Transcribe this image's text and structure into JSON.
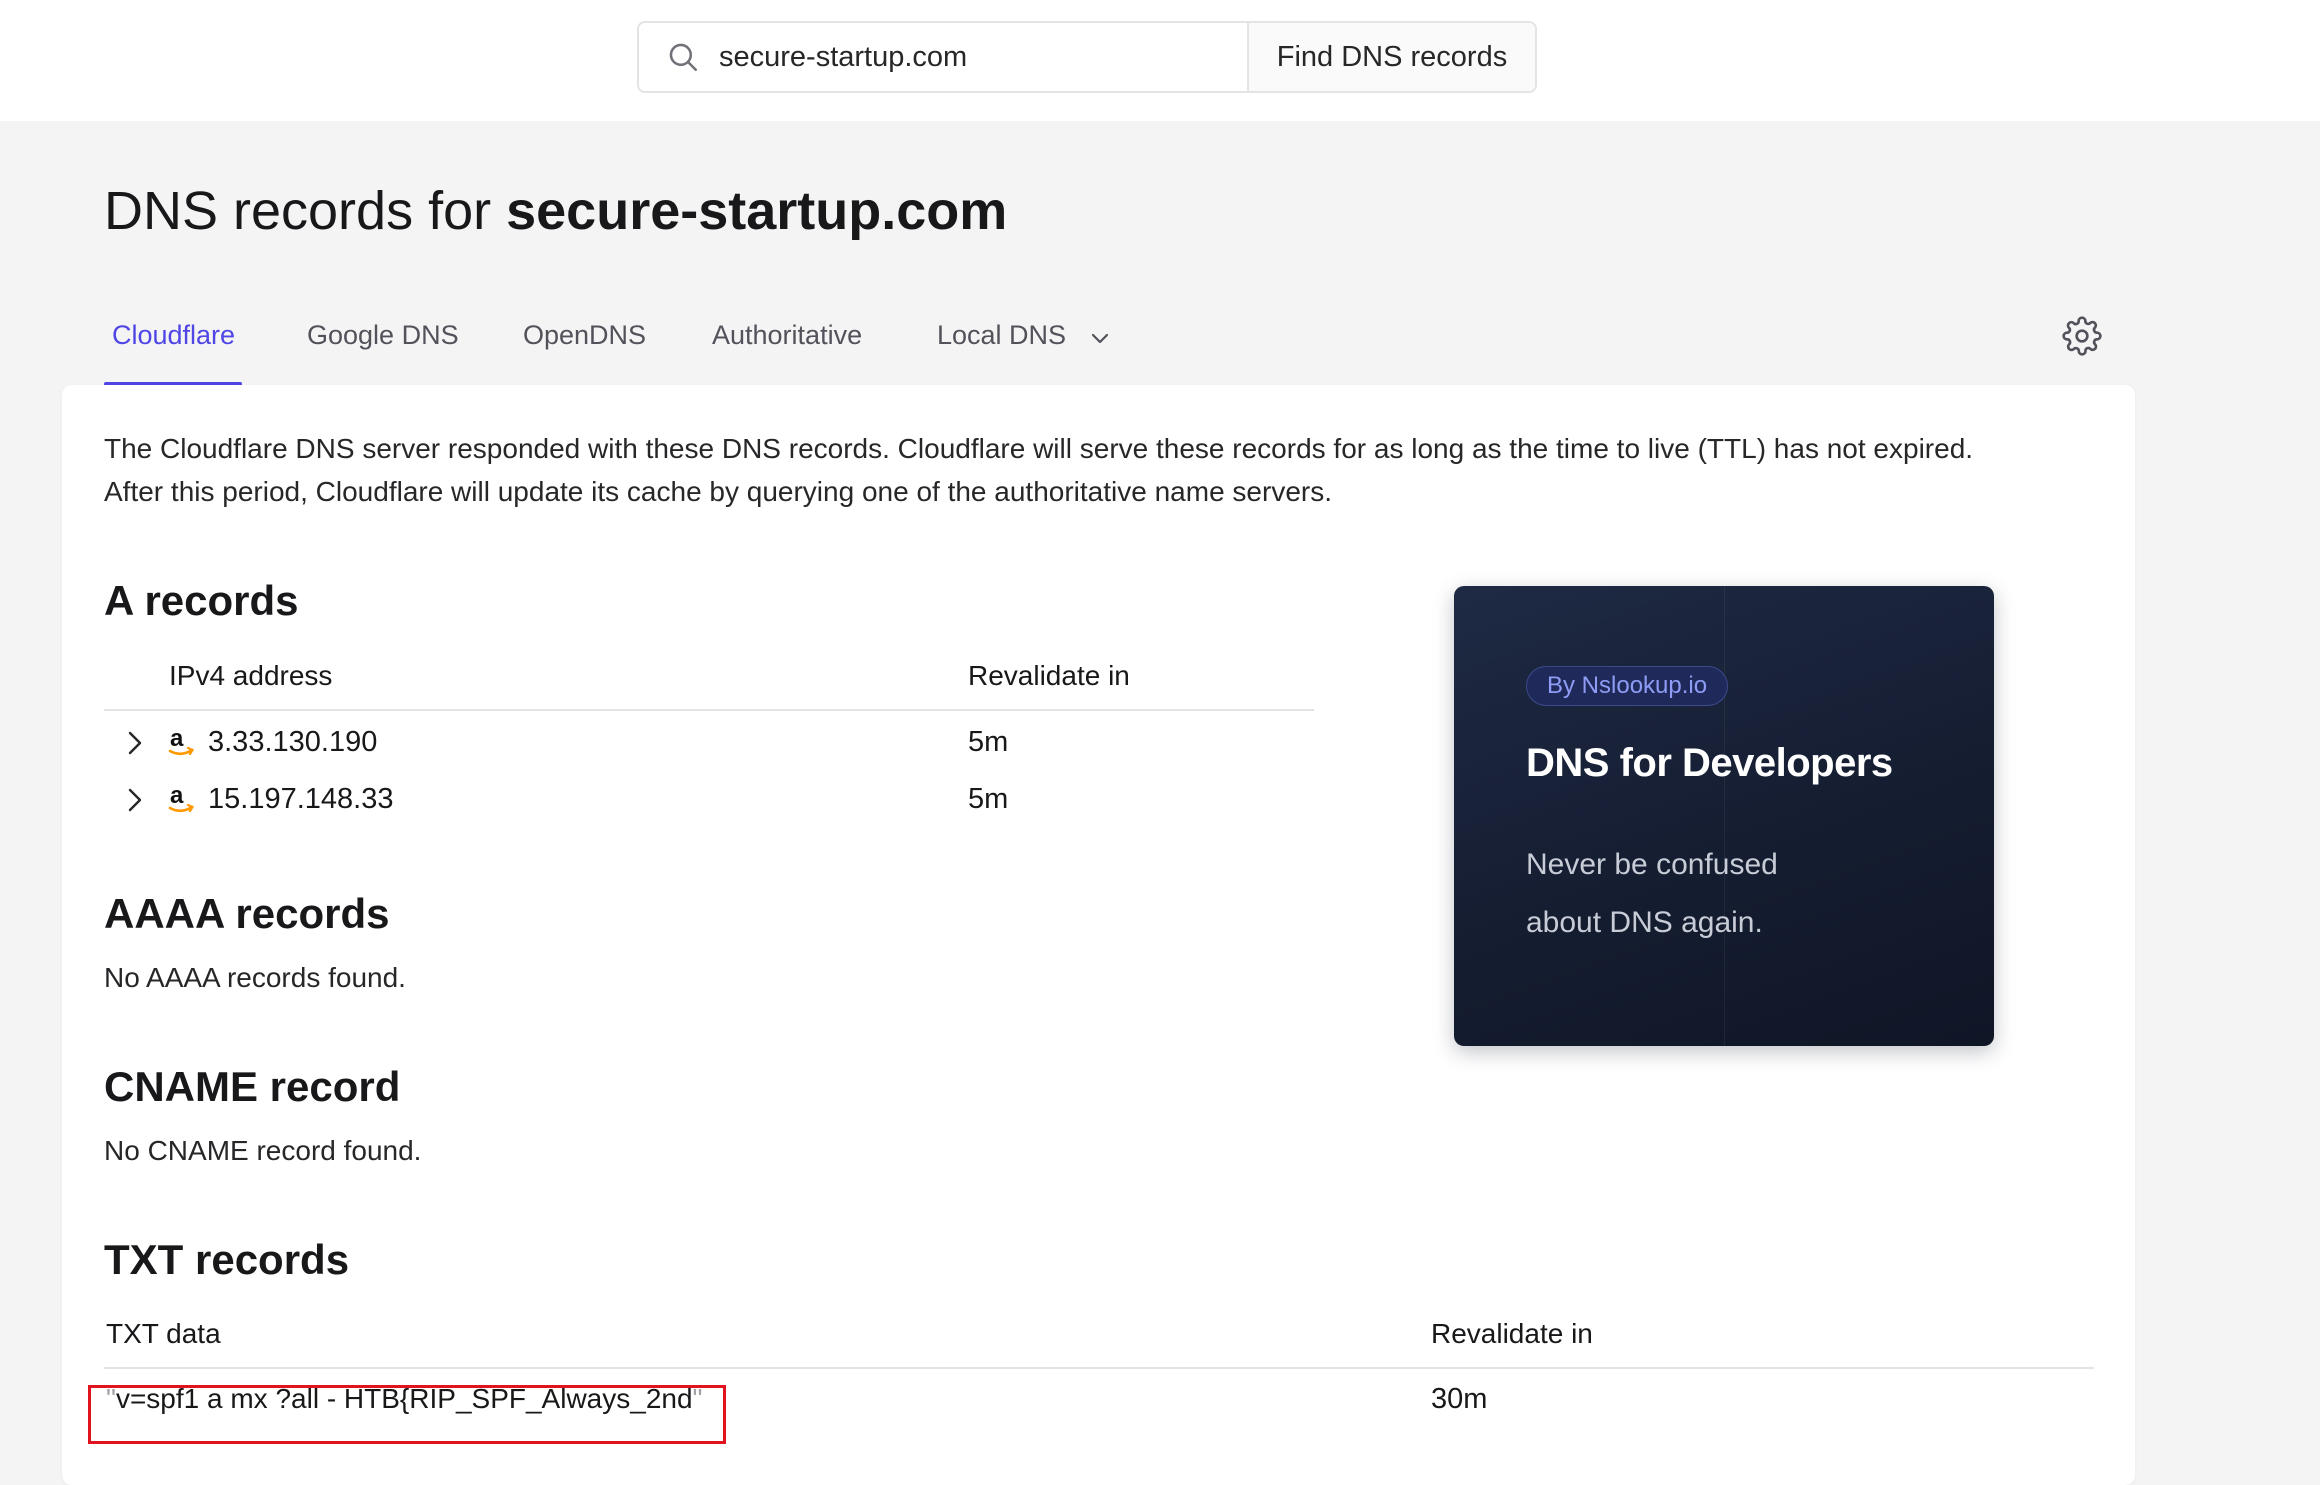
{
  "search": {
    "value": "secure-startup.com",
    "button_label": "Find DNS records"
  },
  "page": {
    "title_prefix": "DNS records for ",
    "title_domain": "secure-startup.com"
  },
  "tabs": [
    {
      "label": "Cloudflare",
      "active": true
    },
    {
      "label": "Google DNS",
      "active": false
    },
    {
      "label": "OpenDNS",
      "active": false
    },
    {
      "label": "Authoritative",
      "active": false
    },
    {
      "label": "Local DNS",
      "active": false
    }
  ],
  "intro": {
    "line1": "The Cloudflare DNS server responded with these DNS records. Cloudflare will serve these records for as long as the time to live (TTL) has not expired.",
    "line2": "After this period, Cloudflare will update its cache by querying one of the authoritative name servers."
  },
  "a_records": {
    "title": "A records",
    "col_address": "IPv4 address",
    "col_revalidate": "Revalidate in",
    "rows": [
      {
        "address": "3.33.130.190",
        "revalidate": "5m",
        "provider_icon": "amazon-icon"
      },
      {
        "address": "15.197.148.33",
        "revalidate": "5m",
        "provider_icon": "amazon-icon"
      }
    ]
  },
  "aaaa_records": {
    "title": "AAAA records",
    "empty_text": "No AAAA records found."
  },
  "cname_record": {
    "title": "CNAME record",
    "empty_text": "No CNAME record found."
  },
  "txt_records": {
    "title": "TXT records",
    "col_data": "TXT data",
    "col_revalidate": "Revalidate in",
    "rows": [
      {
        "open_quote": "\"",
        "data": "v=spf1 a mx ?all - HTB{RIP_SPF_Always_2nd",
        "close_quote": "\"",
        "revalidate": "30m"
      }
    ]
  },
  "promo": {
    "badge": "By Nslookup.io",
    "title": "DNS for Developers",
    "subtitle_line1": "Never be confused",
    "subtitle_line2": "about DNS again."
  },
  "colors": {
    "accent": "#4f46e5",
    "highlight_border": "#e0131f",
    "amazon_orange": "#ff9900"
  }
}
